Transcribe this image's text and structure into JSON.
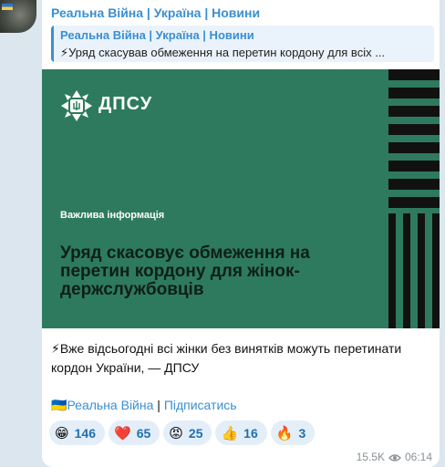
{
  "channel": {
    "name": "Реальна Війна | Україна | Новини"
  },
  "reply": {
    "title": "Реальна Війна | Україна | Новини",
    "text": "⚡Уряд скасував обмеження на перетин кордону для всіх ..."
  },
  "banner": {
    "logo_text": "ДПСУ",
    "info": "Важлива інформація",
    "headline": "Уряд скасовує обмеження на перетин кордону для жінок-держслужбовців",
    "bg_color": "#2e7a5e"
  },
  "message": {
    "text": "⚡Вже відсьогодні всі жінки без винятків можуть перетинати кордон України, — ДПСУ",
    "link_channel": "Реальна Війна",
    "separator": "|",
    "link_subscribe": "Підписатись"
  },
  "reactions": [
    {
      "emoji": "😁",
      "count": "146"
    },
    {
      "emoji": "❤️",
      "count": "65"
    },
    {
      "emoji": "😡",
      "count": "25"
    },
    {
      "emoji": "👍",
      "count": "16"
    },
    {
      "emoji": "🔥",
      "count": "3"
    }
  ],
  "meta": {
    "views": "15.5K",
    "time": "06:14"
  }
}
